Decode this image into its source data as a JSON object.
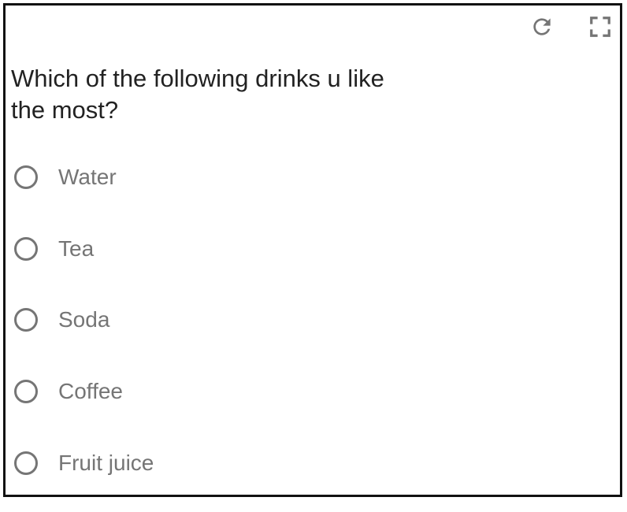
{
  "toolbar": {
    "refresh_icon": "refresh-icon",
    "fullscreen_icon": "fullscreen-icon"
  },
  "question": {
    "line1": "Which of the following drinks u like",
    "line2": "the most?"
  },
  "options": [
    {
      "label": "Water"
    },
    {
      "label": "Tea"
    },
    {
      "label": "Soda"
    },
    {
      "label": "Coffee"
    },
    {
      "label": "Fruit juice"
    }
  ],
  "colors": {
    "border": "#111111",
    "question_text": "#222222",
    "option_text": "#757575",
    "radio_ring": "#757575",
    "icon": "#757575"
  }
}
